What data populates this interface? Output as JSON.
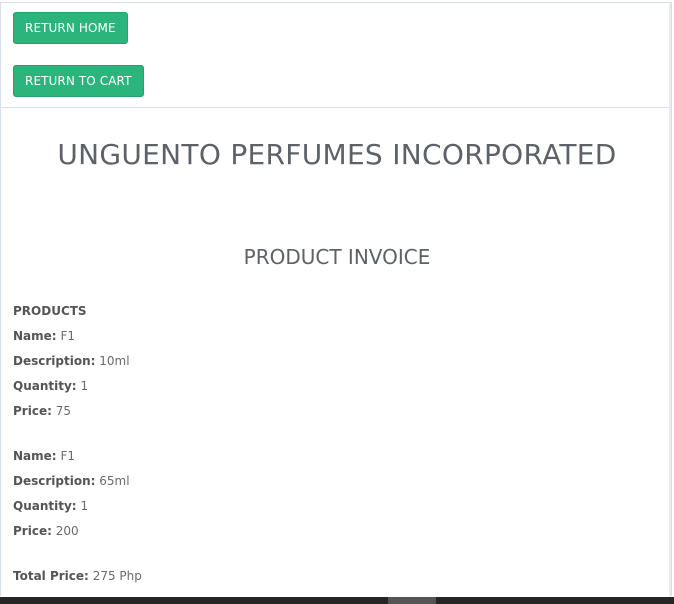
{
  "nav": {
    "return_home": "RETURN HOME",
    "return_to_cart": "RETURN TO CART"
  },
  "company_name": "UNGUENTO PERFUMES INCORPORATED",
  "invoice_title": "PRODUCT INVOICE",
  "products_heading": "PRODUCTS",
  "labels": {
    "name": "Name",
    "description": "Description",
    "quantity": "Quantity",
    "price": "Price",
    "total_price": "Total Price"
  },
  "products": [
    {
      "name": "F1",
      "description": "10ml",
      "quantity": "1",
      "price": "75"
    },
    {
      "name": "F1",
      "description": "65ml",
      "quantity": "1",
      "price": "200"
    }
  ],
  "total_price": "275 Php",
  "colors": {
    "button_bg": "#2bb47b",
    "heading_text": "#5d6268"
  }
}
